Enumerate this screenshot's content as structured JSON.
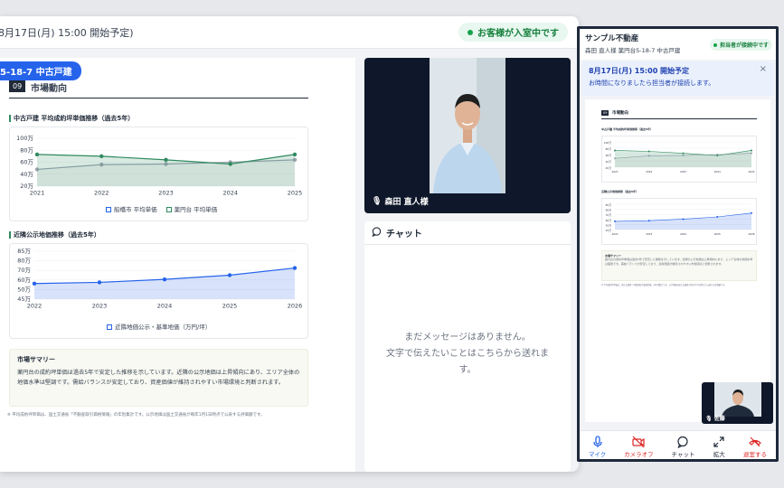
{
  "topbar": {
    "date_text": "8月17日(月) 15:00 開始予定)",
    "status": "お客様が入室中です"
  },
  "doc": {
    "property_tag": "5-18-7 中古戸建",
    "section_number": "09",
    "section_title": "市場動向",
    "summary_title": "市場サマリー",
    "summary_text": "薬円台の成約坪単価は過去5年で安定した推移を示しています。近隣の公示地価は上昇傾向にあり、エリア全体の地価水準は堅調です。需給バランスが安定しており、資産価値が維持されやすい市場環境と判断されます。",
    "footnote": "※ 平均成約坪単価は、国土交通省「不動産取引価格情報」の年別集計です。公示地価は国土交通省が毎年1月1日時点で公表する評価額です。"
  },
  "chart_data": [
    {
      "type": "area",
      "title": "中古戸建 平均成約坪単価推移（過去5年）",
      "categories": [
        "2021",
        "2022",
        "2023",
        "2024",
        "2025"
      ],
      "y_tick_labels": [
        "100万",
        "80万",
        "60万",
        "40万",
        "20万"
      ],
      "ylim": [
        20,
        100
      ],
      "series": [
        {
          "name": "船橋市 平均単価",
          "values": [
            48,
            56,
            57,
            60,
            64
          ],
          "color": "#9ca3af"
        },
        {
          "name": "薬円台 平均単価",
          "values": [
            73,
            70,
            64,
            57,
            73
          ],
          "color": "#2f8a5f"
        }
      ],
      "legend": "bottom"
    },
    {
      "type": "area",
      "title": "近隣公示地価推移（過去5年）",
      "categories": [
        "2022",
        "2023",
        "2024",
        "2025",
        "2026"
      ],
      "y_tick_labels": [
        "85万",
        "80万",
        "70万",
        "60万",
        "50万",
        "45万"
      ],
      "ylim": [
        45,
        85
      ],
      "series": [
        {
          "name": "近隣地価公示・基準地価（万円/坪）",
          "values": [
            58,
            59,
            61.5,
            65,
            71
          ],
          "color": "#2563eb"
        }
      ],
      "legend": "bottom"
    }
  ],
  "video": {
    "name": "森田 直人様"
  },
  "chat": {
    "title": "チャット",
    "empty_line1": "まだメッセージはありません。",
    "empty_line2": "文字で伝えたいことはこちらから送れま",
    "empty_line3": "す。"
  },
  "phone": {
    "company": "サンプル不動産",
    "subtitle": "森田 直人様 薬円台5-18-7 中古戸建",
    "badge": "担当者が接続中です",
    "notice_title": "8月17日(月) 15:00 開始予定",
    "notice_text": "お時間になりましたら担当者が接続します。",
    "mini_section": "市場動向",
    "pip_name": "佐藤",
    "toolbar": [
      "マイク",
      "カメラオフ",
      "チャット",
      "拡大",
      "退室する"
    ]
  }
}
